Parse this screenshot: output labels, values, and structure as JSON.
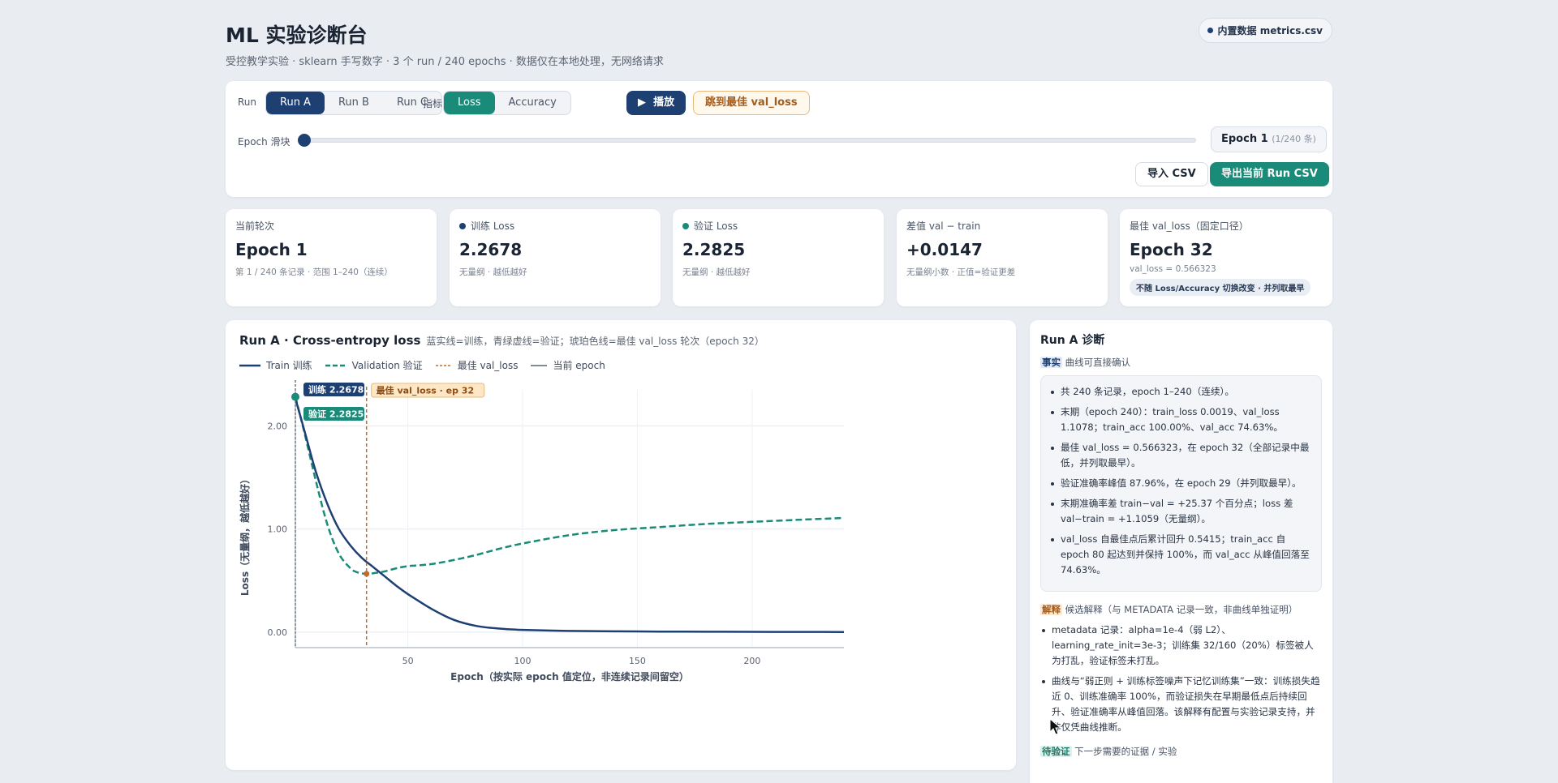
{
  "header": {
    "title": "ML 实验诊断台",
    "subtitle": "受控教学实验 · sklearn 手写数字 · 3 个 run / 240 epochs · 数据仅在本地处理，无网络请求",
    "data_source": "内置数据 metrics.csv"
  },
  "controls": {
    "run_label": "Run",
    "runs": [
      "Run A",
      "Run B",
      "Run C"
    ],
    "active_run": "Run A",
    "metric_label": "指标",
    "metrics": [
      "Loss",
      "Accuracy"
    ],
    "active_metric": "Loss",
    "play_label": "播放",
    "jump_best_label": "跳到最佳 val_loss",
    "slider_label": "Epoch 滑块",
    "slider_value": 1,
    "slider_min": 1,
    "slider_max": 240,
    "epoch_display": "Epoch 1",
    "epoch_count": "(1/240 条)",
    "import_label": "导入 CSV",
    "export_label": "导出当前 Run CSV"
  },
  "kpis": {
    "current": {
      "label": "当前轮次",
      "value": "Epoch 1",
      "note": "第 1 / 240 条记录 · 范围 1–240（连续）"
    },
    "train": {
      "label": "训练 Loss",
      "value": "2.2678",
      "note": "无量纲 · 越低越好"
    },
    "val": {
      "label": "验证 Loss",
      "value": "2.2825",
      "note": "无量纲 · 越低越好"
    },
    "gap": {
      "label": "差值 val − train",
      "value": "+0.0147",
      "note": "无量纲小数 · 正值=验证更差"
    },
    "best": {
      "label": "最佳 val_loss（固定口径）",
      "value": "Epoch 32",
      "note": "val_loss = 0.566323",
      "tag": "不随 Loss/Accuracy 切换改变 · 并列取最早"
    }
  },
  "chart": {
    "title": "Run A · Cross-entropy loss",
    "subtitle": "蓝实线=训练，青绿虚线=验证；琥珀色线=最佳 val_loss 轮次（epoch 32）",
    "legend": [
      "Train 训练",
      "Validation 验证",
      "最佳 val_loss",
      "当前 epoch"
    ],
    "tooltip_train": "训练 2.2678",
    "tooltip_val": "验证 2.2825",
    "best_label": "最佳 val_loss · ep 32",
    "colors": {
      "train": "#1e3f72",
      "val": "#1a8b78",
      "best": "#c26a2a",
      "current": "#5b6472"
    }
  },
  "chart_data": {
    "type": "line",
    "xlabel": "Epoch（按实际 epoch 值定位，非连续记录间留空）",
    "ylabel": "Loss（无量纲，越低越好）",
    "xlim": [
      1,
      240
    ],
    "ylim": [
      -0.15,
      2.35
    ],
    "x_ticks": [
      50,
      100,
      150,
      200
    ],
    "y_ticks": [
      0.0,
      1.0,
      2.0
    ],
    "y_tick_labels": [
      "0.00",
      "1.00",
      "2.00"
    ],
    "grid": true,
    "best_epoch": 32,
    "best_val_loss": 0.566323,
    "current_epoch": 1,
    "series": [
      {
        "name": "Train 训练",
        "x": [
          1,
          5,
          10,
          15,
          20,
          25,
          30,
          35,
          40,
          45,
          50,
          60,
          70,
          80,
          90,
          100,
          120,
          140,
          160,
          180,
          200,
          220,
          240
        ],
        "values": [
          2.2678,
          1.95,
          1.55,
          1.24,
          1.0,
          0.84,
          0.72,
          0.63,
          0.54,
          0.45,
          0.37,
          0.23,
          0.12,
          0.06,
          0.035,
          0.022,
          0.012,
          0.008,
          0.006,
          0.004,
          0.003,
          0.0025,
          0.0019
        ]
      },
      {
        "name": "Validation 验证",
        "x": [
          1,
          5,
          10,
          15,
          20,
          25,
          28,
          32,
          36,
          40,
          45,
          50,
          60,
          70,
          80,
          90,
          100,
          120,
          140,
          160,
          180,
          200,
          220,
          240
        ],
        "values": [
          2.2825,
          1.93,
          1.46,
          1.04,
          0.76,
          0.62,
          0.58,
          0.566,
          0.575,
          0.59,
          0.62,
          0.64,
          0.66,
          0.7,
          0.75,
          0.81,
          0.86,
          0.94,
          0.99,
          1.02,
          1.05,
          1.07,
          1.09,
          1.1078
        ]
      }
    ]
  },
  "diagnosis": {
    "title": "Run A 诊断",
    "facts_key": "事实",
    "facts_desc": "曲线可直接确认",
    "facts": [
      "共 240 条记录，epoch 1–240（连续）。",
      "末期（epoch 240）：train_loss 0.0019、val_loss 1.1078；train_acc 100.00%、val_acc 74.63%。",
      "最佳 val_loss = 0.566323，在 epoch 32（全部记录中最低，并列取最早）。",
      "验证准确率峰值 87.96%，在 epoch 29（并列取最早）。",
      "末期准确率差 train−val = +25.37 个百分点；loss 差 val−train = +1.1059（无量纲）。",
      "val_loss 自最佳点后累计回升 0.5415；train_acc 自 epoch 80 起达到并保持 100%，而 val_acc 从峰值回落至 74.63%。"
    ],
    "interp_key": "解释",
    "interp_desc": "候选解释（与 METADATA 记录一致，非曲线单独证明）",
    "interp": [
      "metadata 记录：alpha=1e-4（弱 L2）、learning_rate_init=3e-3；训练集 32/160（20%）标签被人为打乱，验证标签未打乱。",
      "曲线与“弱正则 + 训练标签噪声下记忆训练集”一致：训练损失趋近 0、训练准确率 100%，而验证损失在早期最低点后持续回升、验证准确率从峰值回落。该解释有配置与实验记录支持，并非仅凭曲线推断。"
    ],
    "pending_key": "待验证",
    "pending_desc": "下一步需要的证据 / 实验"
  }
}
